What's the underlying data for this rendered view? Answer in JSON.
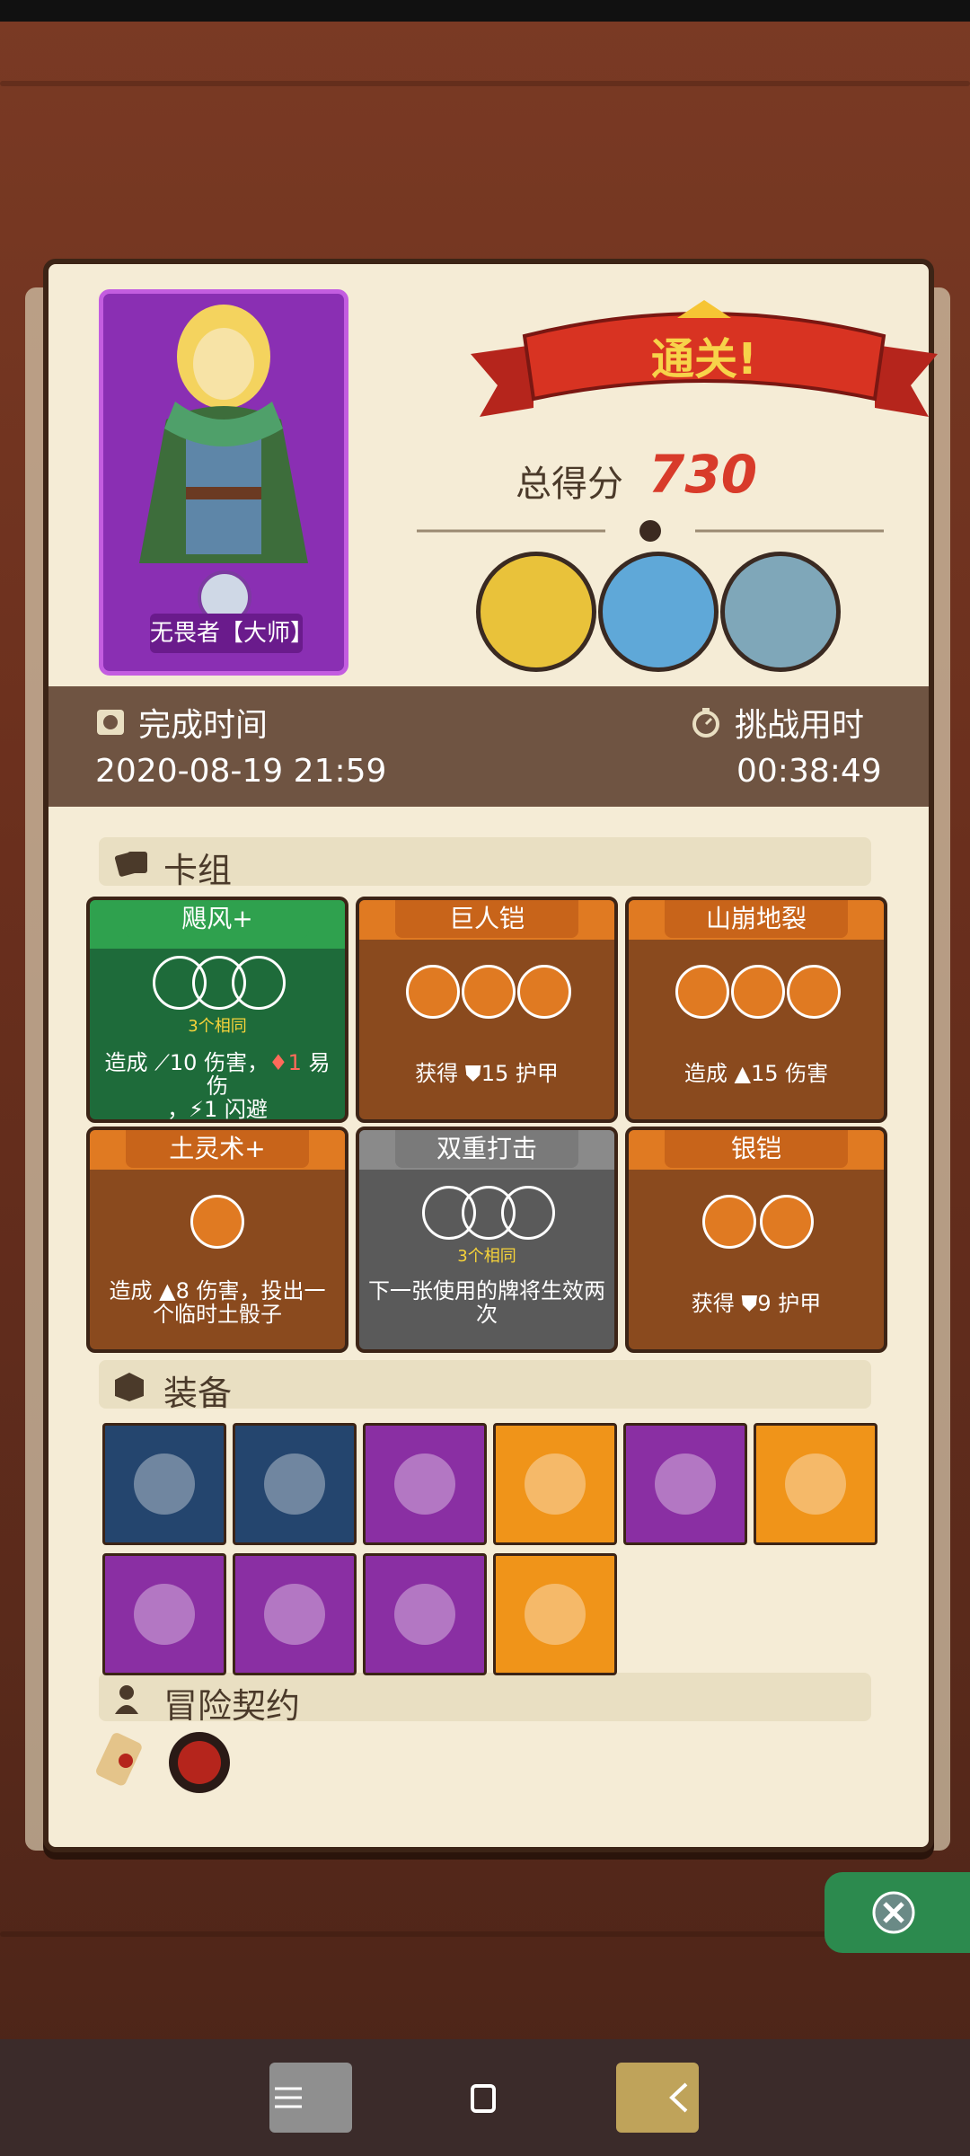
{
  "result": {
    "banner_text": "通关!",
    "score_label": "总得分",
    "score_value": "730"
  },
  "hero": {
    "name": "无畏者【大师】"
  },
  "info": {
    "finish_label": "完成时间",
    "finish_value": "2020-08-19 21:59",
    "duration_label": "挑战用时",
    "duration_value": "00:38:49"
  },
  "sections": {
    "deck": "卡组",
    "equipment": "装备",
    "contract": "冒险契约"
  },
  "cards": [
    {
      "title": "飓风+",
      "sub": "3个相同",
      "desc1": "造成 ⟋10 伤害，",
      "desc_v": "1",
      "desc2": " 易伤",
      "desc3": "，⚡1 闪避",
      "color": "#1e6b3a",
      "head": "#2fa14e"
    },
    {
      "title": "巨人铠",
      "desc": "获得 ⛊15 护甲",
      "color": "#8a4a1e",
      "head": "#e07a22"
    },
    {
      "title": "山崩地裂",
      "desc": "造成 ▲15 伤害",
      "color": "#8a4a1e",
      "head": "#e07a22"
    },
    {
      "title": "土灵术+",
      "desc": "造成 ▲8 伤害，投出一个临时土骰子",
      "color": "#8a4a1e",
      "head": "#e07a22"
    },
    {
      "title": "双重打击",
      "sub": "3个相同",
      "desc": "下一张使用的牌将生效两次",
      "color": "#5a5a5a",
      "head": "#8a8a8a"
    },
    {
      "title": "银铠",
      "desc": "获得 ⛊9 护甲",
      "color": "#8a4a1e",
      "head": "#e07a22"
    }
  ],
  "equipment": [
    {
      "icon": "scroll-icon",
      "bg": "#24456e"
    },
    {
      "icon": "blue-shield-icon",
      "bg": "#24456e"
    },
    {
      "icon": "boots-icon",
      "bg": "#8a2fa3"
    },
    {
      "icon": "pink-orb-key-icon",
      "bg": "#f09419"
    },
    {
      "icon": "gold-ring-icon",
      "bg": "#8a2fa3"
    },
    {
      "icon": "potion-jar-icon",
      "bg": "#f09419"
    },
    {
      "icon": "leather-bracer-icon",
      "bg": "#8a2fa3"
    },
    {
      "icon": "diamond-ring-icon",
      "bg": "#8a2fa3"
    },
    {
      "icon": "skull-book-icon",
      "bg": "#8a2fa3"
    },
    {
      "icon": "phoenix-feather-icon",
      "bg": "#f09419"
    }
  ],
  "colors": {
    "panel": "#f5ecd6",
    "infoBar": "#6f5442",
    "scoreRed": "#d83b2a"
  }
}
